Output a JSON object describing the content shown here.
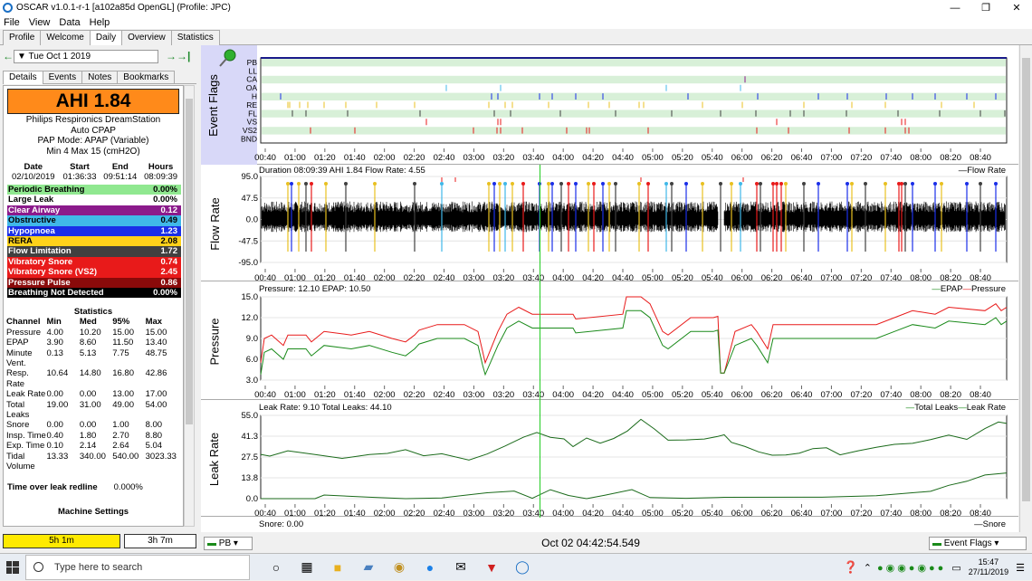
{
  "window": {
    "title": "OSCAR v1.0.1-r-1 [a102a85d OpenGL] (Profile: JPC)"
  },
  "menu": [
    "File",
    "View",
    "Data",
    "Help"
  ],
  "main_tabs": [
    "Profile",
    "Welcome",
    "Daily",
    "Overview",
    "Statistics"
  ],
  "date_nav": {
    "date": "Tue Oct 1 2019"
  },
  "sub_tabs": [
    "Details",
    "Events",
    "Notes",
    "Bookmarks"
  ],
  "ahi": "AHI 1.84",
  "machine": {
    "line1": "Philips Respironics DreamStation",
    "line2": "Auto CPAP",
    "line3": "PAP Mode: APAP (Variable)",
    "line4": "Min 4 Max 15 (cmH2O)"
  },
  "session": {
    "headers": [
      "Date",
      "Start",
      "End",
      "Hours"
    ],
    "values": [
      "02/10/2019",
      "01:36:33",
      "09:51:14",
      "08:09:39"
    ]
  },
  "event_rows": [
    {
      "name": "Periodic Breathing",
      "value": "0.00%",
      "bg": "#90e890",
      "fg": "#000"
    },
    {
      "name": "Large Leak",
      "value": "0.00%",
      "bg": "#ffffff",
      "fg": "#000"
    },
    {
      "name": "Clear Airway",
      "value": "0.12",
      "bg": "#8b1a8b",
      "fg": "#fff"
    },
    {
      "name": "Obstructive",
      "value": "0.49",
      "bg": "#40b8e8",
      "fg": "#000"
    },
    {
      "name": "Hypopnoea",
      "value": "1.23",
      "bg": "#1a2ee8",
      "fg": "#fff"
    },
    {
      "name": "RERA",
      "value": "2.08",
      "bg": "#ffd21a",
      "fg": "#000"
    },
    {
      "name": "Flow Limitation",
      "value": "1.72",
      "bg": "#404040",
      "fg": "#fff"
    },
    {
      "name": "Vibratory Snore",
      "value": "0.74",
      "bg": "#e81a1a",
      "fg": "#fff"
    },
    {
      "name": "Vibratory Snore (VS2)",
      "value": "2.45",
      "bg": "#e81a1a",
      "fg": "#fff"
    },
    {
      "name": "Pressure Pulse",
      "value": "0.86",
      "bg": "#8a0a0a",
      "fg": "#fff"
    },
    {
      "name": "Breathing Not Detected",
      "value": "0.00%",
      "bg": "#000000",
      "fg": "#fff"
    }
  ],
  "statistics": {
    "title": "Statistics",
    "headers": [
      "Channel",
      "Min",
      "Med",
      "95%",
      "Max"
    ],
    "rows": [
      [
        "Pressure",
        "4.00",
        "10.20",
        "15.00",
        "15.00"
      ],
      [
        "EPAP",
        "3.90",
        "8.60",
        "11.50",
        "13.40"
      ],
      [
        "Minute Vent.",
        "0.13",
        "5.13",
        "7.75",
        "48.75"
      ],
      [
        "Resp. Rate",
        "10.64",
        "14.80",
        "16.80",
        "42.86"
      ],
      [
        "Leak Rate",
        "0.00",
        "0.00",
        "13.00",
        "17.00"
      ],
      [
        "Total Leaks",
        "19.00",
        "31.00",
        "49.00",
        "54.00"
      ],
      [
        "Snore",
        "0.00",
        "0.00",
        "1.00",
        "8.00"
      ],
      [
        "Insp. Time",
        "0.40",
        "1.80",
        "2.70",
        "8.80"
      ],
      [
        "Exp. Time",
        "0.10",
        "2.14",
        "2.64",
        "5.04"
      ],
      [
        "Tidal Volume",
        "13.33",
        "340.00",
        "540.00",
        "3023.33"
      ]
    ]
  },
  "leak_redline": {
    "label": "Time over leak redline",
    "value": "0.000%"
  },
  "machine_settings": "Machine Settings",
  "bottom_buttons": {
    "left": "5h 1m",
    "right": "3h 7m"
  },
  "time_ticks": [
    "00:40",
    "01:00",
    "01:20",
    "01:40",
    "02:00",
    "02:20",
    "02:40",
    "03:00",
    "03:20",
    "03:40",
    "04:00",
    "04:20",
    "04:40",
    "05:00",
    "05:20",
    "05:40",
    "06:00",
    "06:20",
    "06:40",
    "07:00",
    "07:20",
    "07:40",
    "08:00",
    "08:20",
    "08:40"
  ],
  "event_flags": {
    "title": "Event Flags",
    "rows": [
      "PB",
      "LL",
      "CA",
      "OA",
      "H",
      "RE",
      "FL",
      "VS",
      "VS2",
      "BND"
    ]
  },
  "flow_rate": {
    "title": "Flow Rate",
    "header": "Duration 08:09:39 AHI 1.84 Flow Rate: 4.55",
    "legend": "Flow Rate",
    "yticks": [
      "95.0",
      "47.5",
      "0.0",
      "-47.5",
      "-95.0"
    ]
  },
  "pressure": {
    "title": "Pressure",
    "header": "Pressure: 12.10 EPAP: 10.50",
    "legend_epap": "EPAP",
    "legend_pressure": "Pressure",
    "yticks": [
      "15.0",
      "12.0",
      "9.0",
      "6.0",
      "3.0"
    ]
  },
  "leak_rate": {
    "title": "Leak Rate",
    "header": "Leak Rate: 9.10 Total Leaks: 44.10",
    "legend_total": "Total Leaks",
    "legend_leak": "Leak Rate",
    "yticks": [
      "55.0",
      "41.3",
      "27.5",
      "13.8",
      "0.0"
    ]
  },
  "snore": {
    "header": "Snore: 0.00",
    "legend": "Snore"
  },
  "status": {
    "channel": "PB",
    "datetime": "Oct 02 04:42:54.549",
    "layout": "Event Flags"
  },
  "taskbar": {
    "search": "Type here to search",
    "time": "15:47",
    "date": "27/11/2019"
  },
  "colors": {
    "epap": "#1a8a1a",
    "pressure": "#e81a1a",
    "crosshair": "#22cc22"
  }
}
